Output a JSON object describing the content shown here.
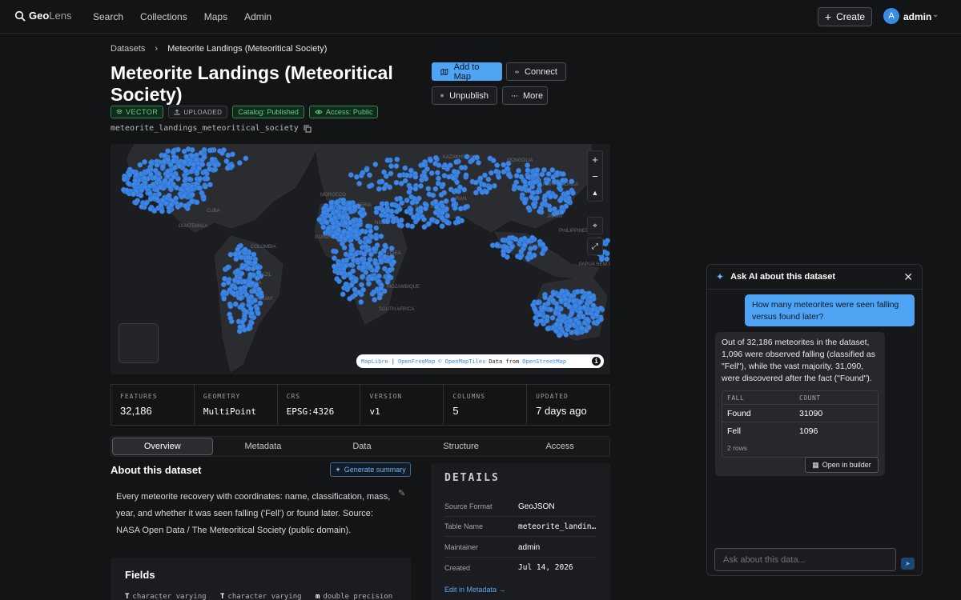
{
  "app": {
    "logo_primary": "Geo",
    "logo_secondary": "Lens"
  },
  "nav": [
    "Search",
    "Collections",
    "Maps",
    "Admin"
  ],
  "header": {
    "create_label": "Create",
    "avatar_letter": "A",
    "user_name": "admin"
  },
  "breadcrumb": {
    "root": "Datasets",
    "current": "Meteorite Landings (Meteoritical Society)"
  },
  "dataset": {
    "title": "Meteorite Landings (Meteoritical Society)",
    "badges": {
      "vector": "VECTOR",
      "uploaded": "UPLOADED",
      "catalog": "Catalog: Published",
      "access": "Access: Public"
    },
    "slug": "meteorite_landings_meteoritical_society"
  },
  "actions": {
    "add_to_map": "Add to Map",
    "connect": "Connect",
    "unpublish": "Unpublish",
    "more": "More"
  },
  "map": {
    "labels": [
      "KAZAKHSTAN",
      "MONGOLIA",
      "NORTH KOREA",
      "JAPAN",
      "MOROCCO",
      "ALGERIA",
      "NIGER",
      "SAUDI ARABIA",
      "IRAN",
      "PHILIPPINES",
      "MALAYSIA",
      "PAPUA NEW GUINEA",
      "GUINEA",
      "EQUATORIAL GUINEA",
      "ANGOLA",
      "MOZAMBIQUE",
      "SOUTH AFRICA",
      "COLOMBIA",
      "BRAZIL",
      "BOLIVIA",
      "PARAGUAY",
      "CUBA",
      "GUATEMALA"
    ],
    "attribution": {
      "maplibre": "MapLibre",
      "sep": "|",
      "openfreemap": "OpenFreeMap",
      "omt": "© OpenMapTiles",
      "data_from": "Data from",
      "osm": "OpenStreetMap"
    },
    "point_color": "#3d86e6"
  },
  "stats": [
    {
      "label": "FEATURES",
      "value": "32,186"
    },
    {
      "label": "GEOMETRY",
      "value": "MultiPoint"
    },
    {
      "label": "CRS",
      "value": "EPSG:4326"
    },
    {
      "label": "VERSION",
      "value": "v1"
    },
    {
      "label": "COLUMNS",
      "value": "5"
    },
    {
      "label": "UPDATED",
      "value": "7 days ago"
    }
  ],
  "tabs": [
    "Overview",
    "Metadata",
    "Data",
    "Structure",
    "Access"
  ],
  "about": {
    "title": "About this dataset",
    "generate_summary": "Generate summary",
    "description": "Every meteorite recovery with coordinates: name, classification, mass, year, and whether it was seen falling ('Fell') or found later. Source: NASA Open Data / The Meteoritical Society (public domain)."
  },
  "fields": {
    "title": "Fields",
    "types": [
      {
        "icon": "T",
        "type": "character varying"
      },
      {
        "icon": "T",
        "type": "character varying"
      },
      {
        "icon": "m",
        "type": "double precision"
      }
    ]
  },
  "details": {
    "title": "DETAILS",
    "rows": [
      {
        "key": "Source Format",
        "value": "GeoJSON"
      },
      {
        "key": "Table Name",
        "value": "meteorite_landin…"
      },
      {
        "key": "Maintainer",
        "value": "admin"
      },
      {
        "key": "Created",
        "value": "Jul 14, 2026"
      }
    ],
    "edit_link": "Edit in Metadata →"
  },
  "ai": {
    "title": "Ask AI about this dataset",
    "question": "How many meteorites were seen falling versus found later?",
    "answer": "Out of 32,186 meteorites in the dataset, 1,096 were observed falling (classified as \"Fell\"), while the vast majority, 31,090, were discovered after the fact (\"Found\").",
    "table": {
      "headers": [
        "FALL",
        "COUNT"
      ],
      "rows": [
        [
          "Found",
          "31090"
        ],
        [
          "Fell",
          "1096"
        ]
      ],
      "footer": "2 rows"
    },
    "open_builder": "Open in builder",
    "input_placeholder": "Ask about this data..."
  },
  "colors": {
    "accent": "#4ea3f2",
    "success": "#5dd185",
    "background": "#131416"
  }
}
